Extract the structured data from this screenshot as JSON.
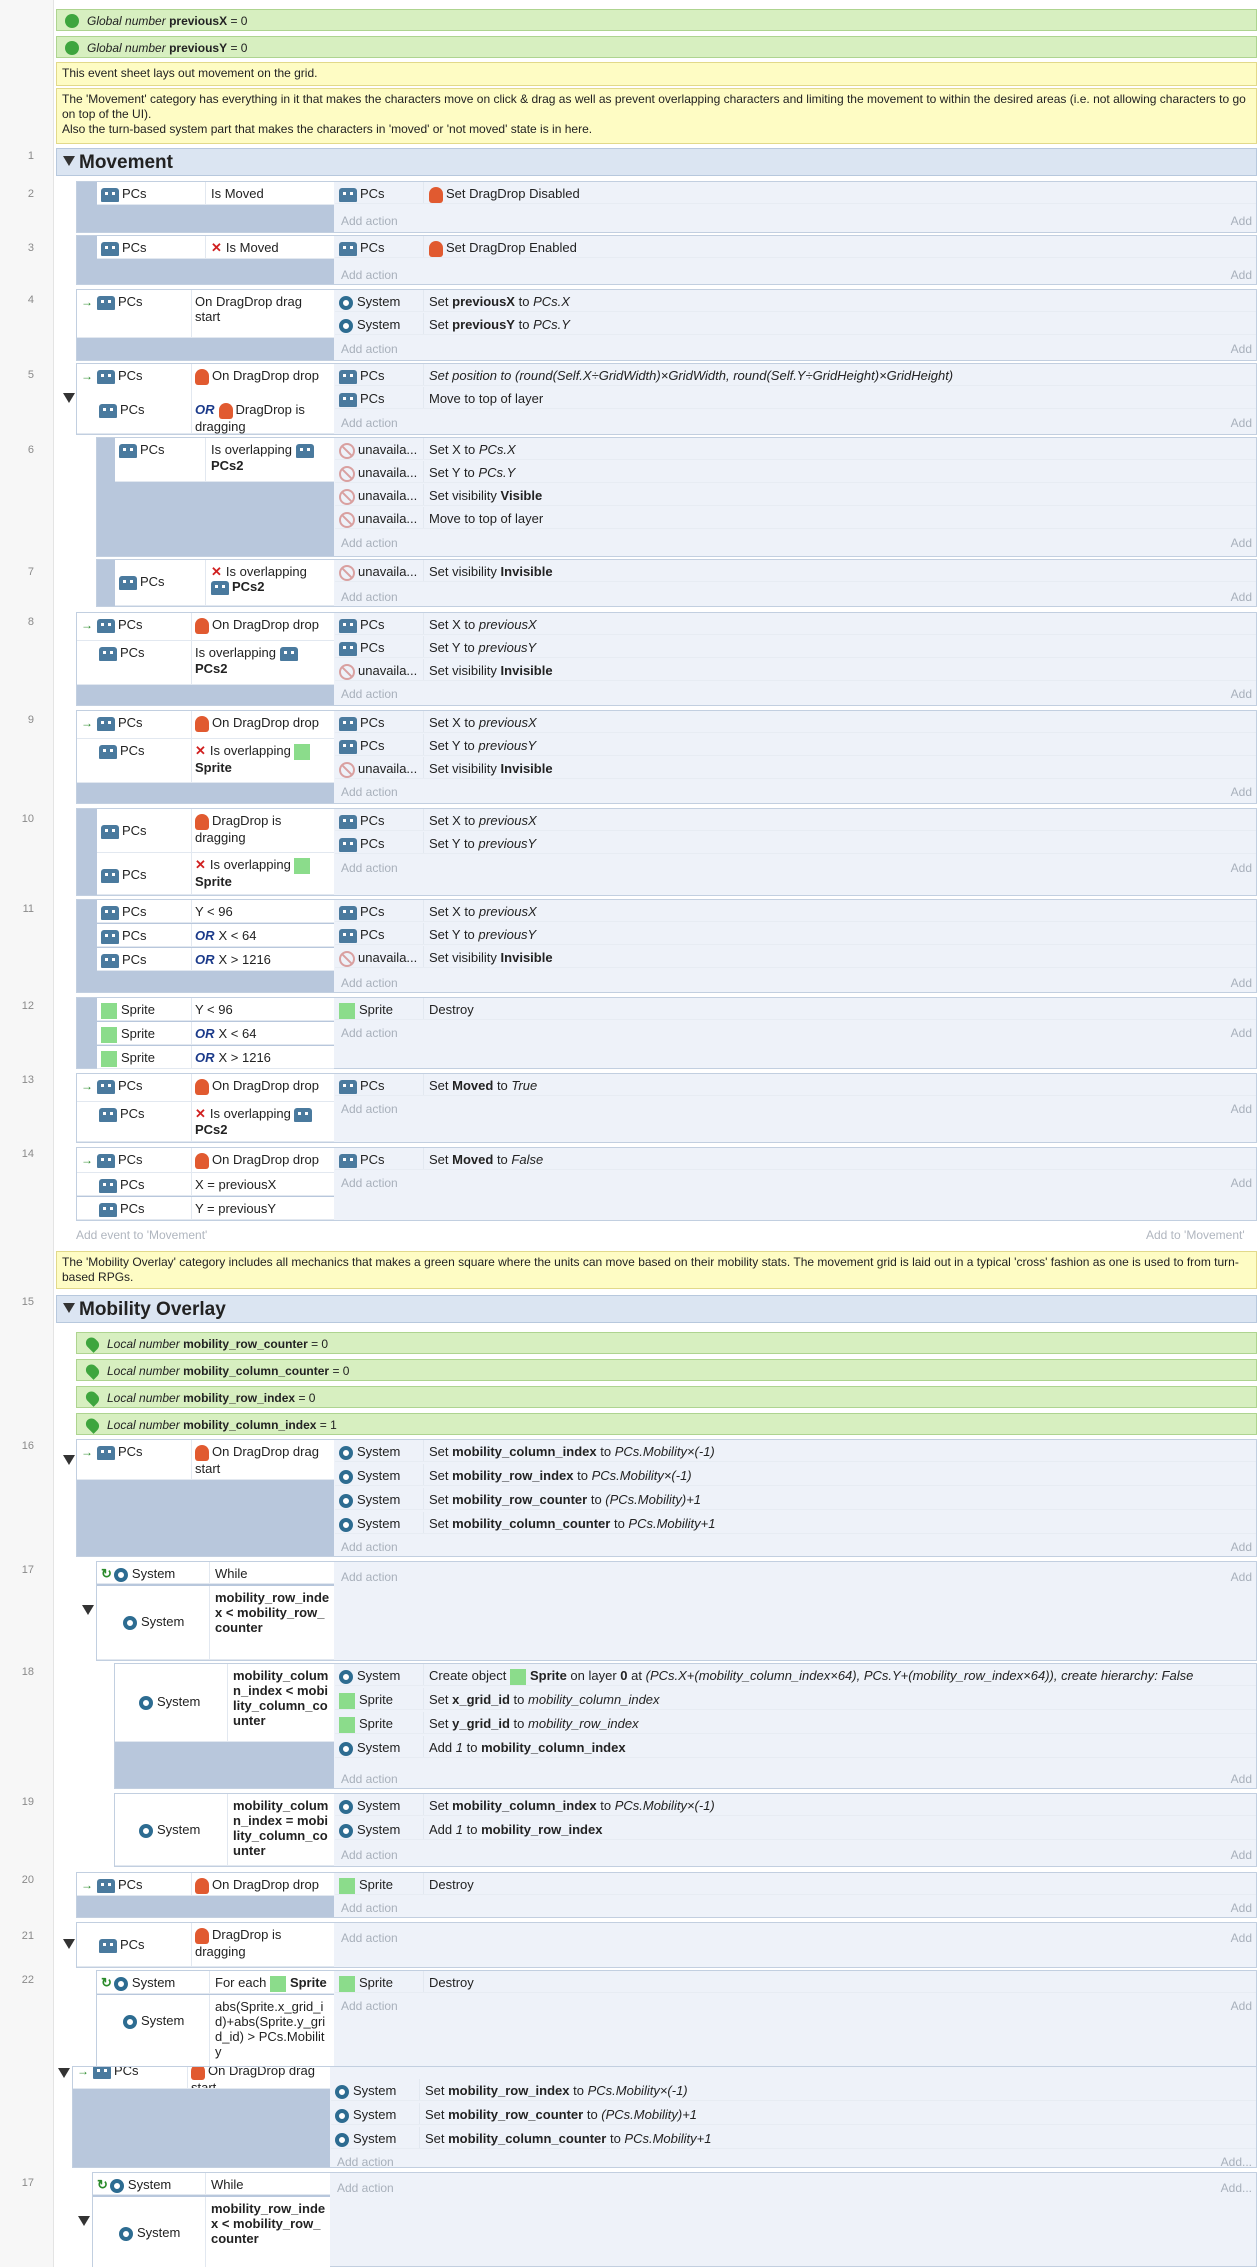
{
  "global_vars": [
    {
      "label": "Global number",
      "name": "previousX",
      "value": "= 0"
    },
    {
      "label": "Global number",
      "name": "previousY",
      "value": "= 0"
    }
  ],
  "comments": {
    "sheet": "This event sheet lays out movement on the grid.",
    "movement": "The 'Movement' category has everything in it that makes the characters move on click & drag as well as prevent overlapping characters and limiting the movement to within the desired areas (i.e. not allowing characters to go on top of the UI).\nAlso the turn-based system part that makes the characters in 'moved' or 'not moved' state is in here.",
    "mobility": "The 'Mobility Overlay' category includes all mechanics that makes a green square where the units can move based on their mobility stats. The movement grid is laid out in a typical 'cross' fashion as one is used to from turn-based RPGs."
  },
  "groups": {
    "movement": "Movement",
    "mobility": "Mobility Overlay"
  },
  "local_vars": [
    {
      "label": "Local number",
      "name": "mobility_row_counter",
      "value": "= 0"
    },
    {
      "label": "Local number",
      "name": "mobility_column_counter",
      "value": "= 0"
    },
    {
      "label": "Local number",
      "name": "mobility_row_index",
      "value": "= 0"
    },
    {
      "label": "Local number",
      "name": "mobility_column_index",
      "value": "= 1"
    }
  ],
  "ui": {
    "add_action": "Add action",
    "add_short": "Add",
    "add_short_dot": "Add...",
    "add_event_movement": "Add event to 'Movement'",
    "add_to_movement": "Add to 'Movement'"
  },
  "line_numbers": [
    "1",
    "2",
    "3",
    "4",
    "5",
    "6",
    "7",
    "8",
    "9",
    "10",
    "11",
    "12",
    "13",
    "14",
    "15",
    "16",
    "17",
    "18",
    "19",
    "20",
    "21",
    "22",
    "17"
  ],
  "objects": {
    "pcs": "PCs",
    "system": "System",
    "sprite": "Sprite",
    "unavail": "unavaila...",
    "pcs2": "PCs2"
  },
  "ev": {
    "e2c1": "Is Moved",
    "e2a1": "Set DragDrop Disabled",
    "e3c1": "Is Moved",
    "e3a1": "Set DragDrop Enabled",
    "e4c1": "On DragDrop drag start",
    "e4a1a": "Set ",
    "e4a1b": "previousX",
    "e4a1c": " to ",
    "e4a1d": "PCs.X",
    "e4a2b": "previousY",
    "e4a2d": "PCs.Y",
    "e5c1": "On DragDrop drop",
    "e5c2": "DragDrop is dragging",
    "e5a1": "Set position to (round(Self.X÷GridWidth)×GridWidth, round(Self.Y÷GridHeight)×GridHeight)",
    "e5a2": "Move to top of layer",
    "e6c1": "Is overlapping",
    "e6a1": "Set X to",
    "e6a1v": "PCs.X",
    "e6a2": "Set Y to",
    "e6a2v": "PCs.Y",
    "setvis": "Set visibility",
    "visible": "Visible",
    "invisible": "Invisible",
    "e7c1": "Is overlapping",
    "e8c2": "Is overlapping",
    "setx": "Set X to",
    "sety": "Set Y to",
    "prevx": "previousX",
    "prevy": "previousY",
    "e9c2": "Is overlapping",
    "e10c1": "DragDrop is dragging",
    "e10c2": "Is overlapping",
    "e11c1": "Y < 96",
    "e11c2": "X < 64",
    "e11c3": "X > 1216",
    "or": "OR",
    "destroy": "Destroy",
    "e13a1": "Set",
    "moved": "Moved",
    "to": "to",
    "true": "True",
    "false": "False",
    "e14c2": "X = previousX",
    "e14c3": "Y = previousY",
    "e16a1n": "mobility_column_index",
    "e16a1v": "PCs.Mobility×(-1)",
    "e16a2n": "mobility_row_index",
    "e16a2v": "PCs.Mobility×(-1)",
    "e16a3n": "mobility_row_counter",
    "e16a3v": "(PCs.Mobility)+1",
    "e16a4n": "mobility_column_counter",
    "e16a4v": "PCs.Mobility+1",
    "while": "While",
    "e17c2": "mobility_row_index < mobility_row_counter",
    "e18c1": "mobility_column_index < mobility_column_counter",
    "e18a1": "Create object",
    "e18a1b": "on layer",
    "e18a1c": "0",
    "e18a1d": "at",
    "e18a1e": "(PCs.X+(mobility_column_index×64), PCs.Y+(mobility_row_index×64)), create hierarchy:",
    "e18a2n": "x_grid_id",
    "e18a2v": "mobility_column_index",
    "e18a3n": "y_grid_id",
    "e18a3v": "mobility_row_index",
    "add": "Add",
    "one": "1",
    "e19c1": "mobility_column_index = mobility_column_counter",
    "e20c1": "On DragDrop drop",
    "e21c1": "DragDrop is dragging",
    "foreach": "For each",
    "e22c2": "abs(Sprite.x_grid_id)+abs(Sprite.y_grid_id) > PCs.Mobility",
    "onstart": "On DragDrop drag start"
  }
}
